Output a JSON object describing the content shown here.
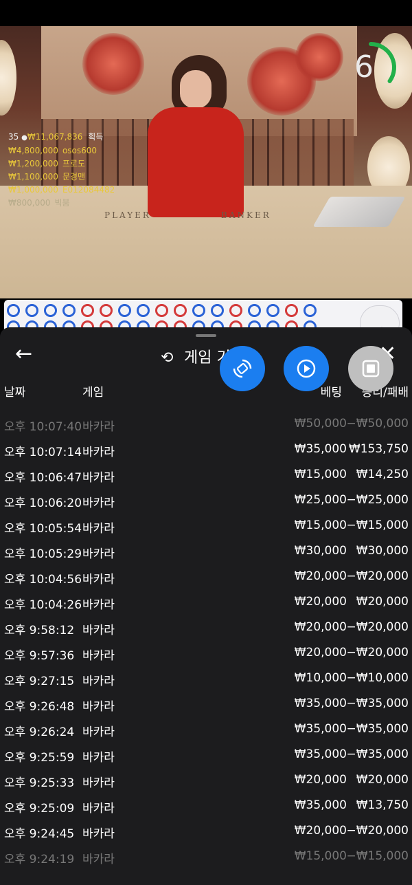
{
  "timer": {
    "value": "6",
    "progress": 0.7
  },
  "winners": {
    "header": {
      "count": "35",
      "amount": "₩11,067,836",
      "label": "획득"
    },
    "list": [
      {
        "amount": "₩4,800,000",
        "name": "osos600",
        "dim": false
      },
      {
        "amount": "₩1,200,000",
        "name": "프로도",
        "dim": false
      },
      {
        "amount": "₩1,100,000",
        "name": "문경맨",
        "dim": false
      },
      {
        "amount": "₩1,000,000",
        "name": "E012084482",
        "dim": false
      },
      {
        "amount": "₩800,000",
        "name": "빅붐",
        "dim": true
      }
    ]
  },
  "table_labels": {
    "player": "PLAYER",
    "banker": "BANKER"
  },
  "sheet": {
    "title": "게임 기록",
    "columns": {
      "date": "날짜",
      "game": "게임",
      "bet": "베팅",
      "win": "승리/패배"
    },
    "rows": [
      {
        "date": "오후 10:07:40",
        "game": "바카라",
        "bet": "₩50,000",
        "win": "−₩50,000"
      },
      {
        "date": "오후 10:07:14",
        "game": "바카라",
        "bet": "₩35,000",
        "win": "₩153,750"
      },
      {
        "date": "오후 10:06:47",
        "game": "바카라",
        "bet": "₩15,000",
        "win": "₩14,250"
      },
      {
        "date": "오후 10:06:20",
        "game": "바카라",
        "bet": "₩25,000",
        "win": "−₩25,000"
      },
      {
        "date": "오후 10:05:54",
        "game": "바카라",
        "bet": "₩15,000",
        "win": "−₩15,000"
      },
      {
        "date": "오후 10:05:29",
        "game": "바카라",
        "bet": "₩30,000",
        "win": "₩30,000"
      },
      {
        "date": "오후 10:04:56",
        "game": "바카라",
        "bet": "₩20,000",
        "win": "−₩20,000"
      },
      {
        "date": "오후 10:04:26",
        "game": "바카라",
        "bet": "₩20,000",
        "win": "₩20,000"
      },
      {
        "date": "오후 9:58:12",
        "game": "바카라",
        "bet": "₩20,000",
        "win": "−₩20,000"
      },
      {
        "date": "오후 9:57:36",
        "game": "바카라",
        "bet": "₩20,000",
        "win": "−₩20,000"
      },
      {
        "date": "오후 9:27:15",
        "game": "바카라",
        "bet": "₩10,000",
        "win": "−₩10,000"
      },
      {
        "date": "오후 9:26:48",
        "game": "바카라",
        "bet": "₩35,000",
        "win": "−₩35,000"
      },
      {
        "date": "오후 9:26:24",
        "game": "바카라",
        "bet": "₩35,000",
        "win": "−₩35,000"
      },
      {
        "date": "오후 9:25:59",
        "game": "바카라",
        "bet": "₩35,000",
        "win": "−₩35,000"
      },
      {
        "date": "오후 9:25:33",
        "game": "바카라",
        "bet": "₩20,000",
        "win": "₩20,000"
      },
      {
        "date": "오후 9:25:09",
        "game": "바카라",
        "bet": "₩35,000",
        "win": "₩13,750"
      },
      {
        "date": "오후 9:24:45",
        "game": "바카라",
        "bet": "₩20,000",
        "win": "−₩20,000"
      },
      {
        "date": "오후 9:24:19",
        "game": "바카라",
        "bet": "₩15,000",
        "win": "−₩15,000"
      }
    ]
  },
  "icons": {
    "back": "arrow-left-icon",
    "close": "close-icon",
    "history": "history-icon",
    "rotate": "rotate-icon",
    "replay": "replay-icon",
    "stop": "stop-icon",
    "expand": "chevron-up-icon"
  },
  "colors": {
    "accent": "#1b7ef0",
    "sheet": "#1c1c1e",
    "gold": "#e9c83a",
    "player": "#2a62d6",
    "banker": "#d43a3a",
    "timer": "#22b04a"
  }
}
